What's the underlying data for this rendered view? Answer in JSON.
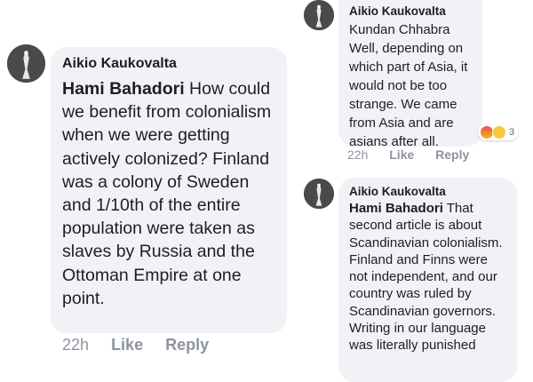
{
  "left_comment": {
    "author": "Aikio Kaukovalta",
    "mention": "Hami Bahadori",
    "text": " How could we benefit from colonialism when we were getting actively colonized? Finland was a colony of Sweden and 1/10th of the entire population were taken as slaves by Russia and the Ottoman Empire at one point.",
    "time": "22h",
    "like": "Like",
    "reply": "Reply",
    "avatar_icon": "user-avatar-icon"
  },
  "right_top_comment": {
    "author": "Aikio Kaukovalta",
    "mention": "Kundan Chhabra",
    "text": " Well, depending on which part of Asia, it would not be too strange. We came from Asia and are asians after all.",
    "time": "22h",
    "like": "Like",
    "reply": "Reply",
    "reaction_count": "3",
    "reactions": [
      "angry-reaction-icon",
      "wow-reaction-icon"
    ]
  },
  "right_bottom_comment": {
    "author": "Aikio Kaukovalta",
    "mention": "Hami Bahadori",
    "text": " That second article is about Scandinavian colonialism. Finland and Finns were not independent, and our country was ruled by Scandinavian governors. Writing in our language was literally punished"
  },
  "colors": {
    "bubble": "#f0f2f5",
    "meta": "#8d949e",
    "text": "#1c1e21"
  }
}
